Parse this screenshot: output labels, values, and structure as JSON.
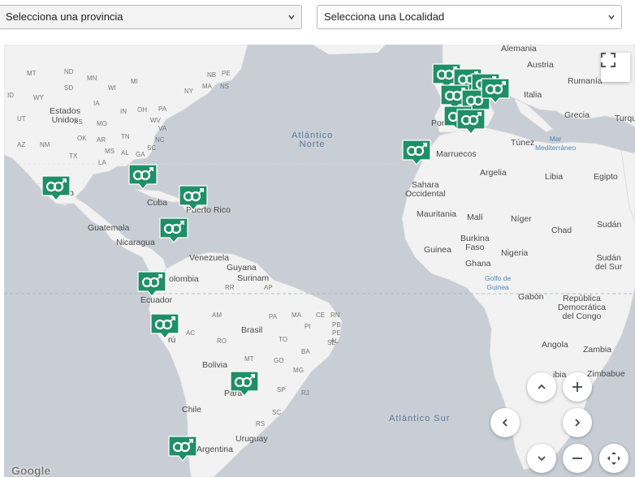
{
  "filters": {
    "province_placeholder": "Selecciona una provincia",
    "locality_placeholder": "Selecciona una Localidad"
  },
  "map": {
    "attribution": "Google",
    "labels": [
      {
        "id": "estados-unidos",
        "text": "Estados\nUnidos",
        "kind": "country"
      },
      {
        "id": "cuba",
        "text": "Cuba",
        "kind": "country"
      },
      {
        "id": "puerto-rico",
        "text": "Puerto Rico",
        "kind": "country"
      },
      {
        "id": "guatemala",
        "text": "Guatemala",
        "kind": "country"
      },
      {
        "id": "nicaragua",
        "text": "Nicaragua",
        "kind": "country"
      },
      {
        "id": "venezuela",
        "text": "Venezuela",
        "kind": "country"
      },
      {
        "id": "guyana",
        "text": "Guyana",
        "kind": "country"
      },
      {
        "id": "surinam",
        "text": "Surinam",
        "kind": "country"
      },
      {
        "id": "colombia",
        "text": "olombia",
        "kind": "country"
      },
      {
        "id": "ecuador",
        "text": "Ecuador",
        "kind": "country"
      },
      {
        "id": "peru",
        "text": "rú",
        "kind": "country"
      },
      {
        "id": "brasil",
        "text": "Brasil",
        "kind": "country"
      },
      {
        "id": "bolivia",
        "text": "Bolivia",
        "kind": "country"
      },
      {
        "id": "paraguay",
        "text": "Para",
        "kind": "country"
      },
      {
        "id": "chile",
        "text": "Chile",
        "kind": "country"
      },
      {
        "id": "uruguay",
        "text": "Uruguay",
        "kind": "country"
      },
      {
        "id": "argentina",
        "text": "Argentina",
        "kind": "country"
      },
      {
        "id": "atlantico-norte",
        "text": "Atlántico\nNorte",
        "kind": "ocean"
      },
      {
        "id": "atlantico-sur",
        "text": "Atlántico Sur",
        "kind": "ocean"
      },
      {
        "id": "alemania",
        "text": "Alemania",
        "kind": "country"
      },
      {
        "id": "austria",
        "text": "Austria",
        "kind": "country"
      },
      {
        "id": "rumania",
        "text": "Rumanía",
        "kind": "country"
      },
      {
        "id": "italia",
        "text": "Italia",
        "kind": "country"
      },
      {
        "id": "grecia",
        "text": "Grecia",
        "kind": "country"
      },
      {
        "id": "turquia",
        "text": "Turqu",
        "kind": "country"
      },
      {
        "id": "portugal",
        "text": "Por",
        "kind": "country"
      },
      {
        "id": "tunez",
        "text": "Túnez",
        "kind": "country"
      },
      {
        "id": "mar-mediterraneo",
        "text": "Mar\nMediterráneo",
        "kind": "blue"
      },
      {
        "id": "marruecos",
        "text": "Marruecos",
        "kind": "country"
      },
      {
        "id": "argelia",
        "text": "Argelia",
        "kind": "country"
      },
      {
        "id": "libia",
        "text": "Libia",
        "kind": "country"
      },
      {
        "id": "egipto",
        "text": "Egipto",
        "kind": "country"
      },
      {
        "id": "sahara",
        "text": "Sahara\nOccidental",
        "kind": "country"
      },
      {
        "id": "mauritania",
        "text": "Mauritania",
        "kind": "country"
      },
      {
        "id": "mali",
        "text": "Malí",
        "kind": "country"
      },
      {
        "id": "niger",
        "text": "Níger",
        "kind": "country"
      },
      {
        "id": "chad",
        "text": "Chad",
        "kind": "country"
      },
      {
        "id": "sudan",
        "text": "Sudán",
        "kind": "country"
      },
      {
        "id": "burkina",
        "text": "Burkina\nFaso",
        "kind": "country"
      },
      {
        "id": "guinea",
        "text": "Guinea",
        "kind": "country"
      },
      {
        "id": "ghana",
        "text": "Ghana",
        "kind": "country"
      },
      {
        "id": "nigeria",
        "text": "Nigeria",
        "kind": "country"
      },
      {
        "id": "golfo-guinea",
        "text": "Golfo de\nGuinea",
        "kind": "blue"
      },
      {
        "id": "sudan-sur",
        "text": "Sudán\ndel Sur",
        "kind": "country"
      },
      {
        "id": "gabon",
        "text": "Gabón",
        "kind": "country"
      },
      {
        "id": "rdc",
        "text": "República\nDemocrática\ndel Congo",
        "kind": "country"
      },
      {
        "id": "angola",
        "text": "Angola",
        "kind": "country"
      },
      {
        "id": "zambia",
        "text": "Zambia",
        "kind": "country"
      },
      {
        "id": "zimbabwe",
        "text": "Zimbabue",
        "kind": "country"
      },
      {
        "id": "namibia",
        "text": "ibia",
        "kind": "country"
      },
      {
        "id": "mexico",
        "text": "o",
        "kind": "country"
      },
      {
        "id": "st-mt",
        "text": "MT",
        "kind": "small"
      },
      {
        "id": "st-nd",
        "text": "ND",
        "kind": "small"
      },
      {
        "id": "st-mn",
        "text": "MN",
        "kind": "small"
      },
      {
        "id": "st-sd",
        "text": "SD",
        "kind": "small"
      },
      {
        "id": "st-wi",
        "text": "WI",
        "kind": "small"
      },
      {
        "id": "st-mi",
        "text": "MI",
        "kind": "small"
      },
      {
        "id": "st-ny",
        "text": "NY",
        "kind": "small"
      },
      {
        "id": "st-ma",
        "text": "MA",
        "kind": "small"
      },
      {
        "id": "st-nb",
        "text": "NB",
        "kind": "small"
      },
      {
        "id": "st-pe",
        "text": "PE",
        "kind": "small"
      },
      {
        "id": "st-ns",
        "text": "NS",
        "kind": "small"
      },
      {
        "id": "st-id",
        "text": "ID",
        "kind": "small"
      },
      {
        "id": "st-wy",
        "text": "WY",
        "kind": "small"
      },
      {
        "id": "st-ia",
        "text": "IA",
        "kind": "small"
      },
      {
        "id": "st-in",
        "text": "IN",
        "kind": "small"
      },
      {
        "id": "st-oh",
        "text": "OH",
        "kind": "small"
      },
      {
        "id": "st-pa",
        "text": "PA",
        "kind": "small"
      },
      {
        "id": "st-ut",
        "text": "UT",
        "kind": "small"
      },
      {
        "id": "st-mo",
        "text": "MO",
        "kind": "small"
      },
      {
        "id": "st-ks",
        "text": "KS",
        "kind": "small"
      },
      {
        "id": "st-wv",
        "text": "WV",
        "kind": "small"
      },
      {
        "id": "st-va",
        "text": "VA",
        "kind": "small"
      },
      {
        "id": "st-ok",
        "text": "OK",
        "kind": "small"
      },
      {
        "id": "st-ar",
        "text": "AR",
        "kind": "small"
      },
      {
        "id": "st-tn",
        "text": "TN",
        "kind": "small"
      },
      {
        "id": "st-nc",
        "text": "NC",
        "kind": "small"
      },
      {
        "id": "st-az",
        "text": "AZ",
        "kind": "small"
      },
      {
        "id": "st-nm",
        "text": "NM",
        "kind": "small"
      },
      {
        "id": "st-ms",
        "text": "MS",
        "kind": "small"
      },
      {
        "id": "st-al",
        "text": "AL",
        "kind": "small"
      },
      {
        "id": "st-ga",
        "text": "GA",
        "kind": "small"
      },
      {
        "id": "st-sc",
        "text": "SC",
        "kind": "small"
      },
      {
        "id": "st-tx",
        "text": "TX",
        "kind": "small"
      },
      {
        "id": "st-la",
        "text": "LA",
        "kind": "small"
      },
      {
        "id": "st-fl",
        "text": "FL",
        "kind": "small"
      },
      {
        "id": "st-rr",
        "text": "RR",
        "kind": "small"
      },
      {
        "id": "st-ap",
        "text": "AP",
        "kind": "small"
      },
      {
        "id": "st-am",
        "text": "AM",
        "kind": "small"
      },
      {
        "id": "st-pa2",
        "text": "PA",
        "kind": "small"
      },
      {
        "id": "st-ma2",
        "text": "MA",
        "kind": "small"
      },
      {
        "id": "st-ce",
        "text": "CE",
        "kind": "small"
      },
      {
        "id": "st-rn",
        "text": "RN",
        "kind": "small"
      },
      {
        "id": "st-pb",
        "text": "PB",
        "kind": "small"
      },
      {
        "id": "st-pi",
        "text": "PI",
        "kind": "small"
      },
      {
        "id": "st-pe2",
        "text": "PE",
        "kind": "small"
      },
      {
        "id": "st-ac",
        "text": "AC",
        "kind": "small"
      },
      {
        "id": "st-ro",
        "text": "RO",
        "kind": "small"
      },
      {
        "id": "st-to",
        "text": "TO",
        "kind": "small"
      },
      {
        "id": "st-ba",
        "text": "BA",
        "kind": "small"
      },
      {
        "id": "st-al2",
        "text": "AL",
        "kind": "small"
      },
      {
        "id": "st-se",
        "text": "SE",
        "kind": "small"
      },
      {
        "id": "st-mt2",
        "text": "MT",
        "kind": "small"
      },
      {
        "id": "st-go",
        "text": "GO",
        "kind": "small"
      },
      {
        "id": "st-mg",
        "text": "MG",
        "kind": "small"
      },
      {
        "id": "st-sp",
        "text": "SP",
        "kind": "small"
      },
      {
        "id": "st-rj",
        "text": "RJ",
        "kind": "small"
      },
      {
        "id": "st-sc2",
        "text": "SC",
        "kind": "small"
      },
      {
        "id": "st-rs",
        "text": "RS",
        "kind": "small"
      }
    ],
    "markers": [
      {
        "id": "mexico",
        "symbol": "⚤"
      },
      {
        "id": "cuba",
        "symbol": "⚤"
      },
      {
        "id": "puerto-rico",
        "symbol": "⚤"
      },
      {
        "id": "nicaragua",
        "symbol": "⚤"
      },
      {
        "id": "colombia",
        "symbol": "⚤"
      },
      {
        "id": "peru",
        "symbol": "⚤"
      },
      {
        "id": "paraguay",
        "symbol": "⚤"
      },
      {
        "id": "argentina",
        "symbol": "⚤"
      },
      {
        "id": "canarias",
        "symbol": "⚤"
      },
      {
        "id": "spain-1",
        "symbol": "⚤"
      },
      {
        "id": "spain-2",
        "symbol": "⚤"
      },
      {
        "id": "spain-3",
        "symbol": "⚤"
      },
      {
        "id": "spain-4",
        "symbol": "⚤"
      },
      {
        "id": "spain-5",
        "symbol": "⚤"
      },
      {
        "id": "spain-6",
        "symbol": "⚤"
      },
      {
        "id": "spain-7",
        "symbol": "⚤"
      },
      {
        "id": "spain-8",
        "symbol": "⚤"
      }
    ],
    "marker_color": "#1f8f67",
    "land_color": "#f2f2f2",
    "water_color": "#c9ced6"
  },
  "controls": {
    "fullscreen": "fullscreen-toggle",
    "zoom_in": "+",
    "zoom_out": "−"
  }
}
